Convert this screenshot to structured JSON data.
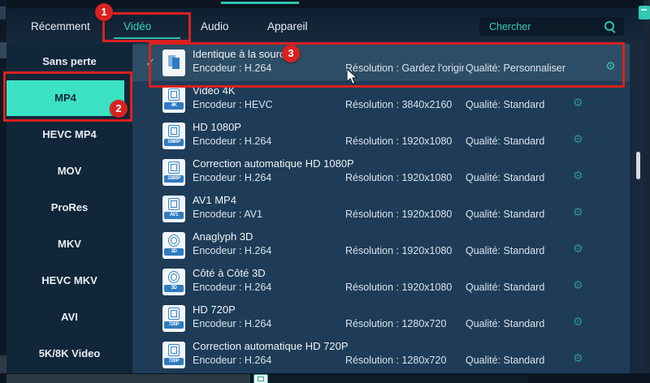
{
  "tabs": [
    {
      "label": "Récemment",
      "active": false
    },
    {
      "label": "Vidéo",
      "active": true
    },
    {
      "label": "Audio",
      "active": false
    },
    {
      "label": "Appareil",
      "active": false
    }
  ],
  "search": {
    "placeholder": "Chercher"
  },
  "sidebar": {
    "items": [
      {
        "label": "Sans perte",
        "selected": false
      },
      {
        "label": "MP4",
        "selected": true
      },
      {
        "label": "HEVC MP4",
        "selected": false
      },
      {
        "label": "MOV",
        "selected": false
      },
      {
        "label": "ProRes",
        "selected": false
      },
      {
        "label": "MKV",
        "selected": false
      },
      {
        "label": "HEVC MKV",
        "selected": false
      },
      {
        "label": "AVI",
        "selected": false
      },
      {
        "label": "5K/8K Video",
        "selected": false
      }
    ]
  },
  "list": {
    "rows": [
      {
        "title": "Identique à la source",
        "encoder": "Encodeur : H.264",
        "resolution": "Résolution : Gardez l'original",
        "quality": "Qualité: Personnaliser",
        "icon": "copy-pages",
        "icon_label": "",
        "selected": true
      },
      {
        "title": "Vidéo 4K",
        "encoder": "Encodeur : HEVC",
        "resolution": "Résolution : 3840x2160",
        "quality": "Qualité: Standard",
        "icon": "video-file",
        "icon_label": "4K",
        "selected": false
      },
      {
        "title": "HD 1080P",
        "encoder": "Encodeur : H.264",
        "resolution": "Résolution : 1920x1080",
        "quality": "Qualité: Standard",
        "icon": "video-file",
        "icon_label": "1080P",
        "selected": false
      },
      {
        "title": "Correction automatique HD 1080P",
        "encoder": "Encodeur : H.264",
        "resolution": "Résolution : 1920x1080",
        "quality": "Qualité: Standard",
        "icon": "video-file",
        "icon_label": "1080P",
        "selected": false
      },
      {
        "title": "AV1 MP4",
        "encoder": "Encodeur : AV1",
        "resolution": "Résolution : 1920x1080",
        "quality": "Qualité: Standard",
        "icon": "video-file",
        "icon_label": "AV1",
        "selected": false
      },
      {
        "title": "Anaglyph 3D",
        "encoder": "Encodeur : H.264",
        "resolution": "Résolution : 1920x1080",
        "quality": "Qualité: Standard",
        "icon": "3d-glasses",
        "icon_label": "3D",
        "selected": false
      },
      {
        "title": "Côté à Côté 3D",
        "encoder": "Encodeur : H.264",
        "resolution": "Résolution : 1920x1080",
        "quality": "Qualité: Standard",
        "icon": "3d-glasses",
        "icon_label": "3D",
        "selected": false
      },
      {
        "title": "HD 720P",
        "encoder": "Encodeur : H.264",
        "resolution": "Résolution : 1280x720",
        "quality": "Qualité: Standard",
        "icon": "video-file",
        "icon_label": "720P",
        "selected": false
      },
      {
        "title": "Correction automatique HD 720P",
        "encoder": "Encodeur : H.264",
        "resolution": "Résolution : 1280x720",
        "quality": "Qualité: Standard",
        "icon": "video-file",
        "icon_label": "720P",
        "selected": false
      }
    ]
  },
  "annotations": {
    "step1": "1",
    "step2": "2",
    "step3": "3"
  },
  "ui": {
    "icons": {
      "check": "✓",
      "gear": "⚙"
    }
  },
  "colors": {
    "accent_teal": "#3ce2c4",
    "annotation_red": "#d92121",
    "selected_row": "#2d4d66",
    "icon_blue": "#2f7cc0",
    "list_bg": "#1e3c57",
    "sidebar_bg": "#122639"
  }
}
